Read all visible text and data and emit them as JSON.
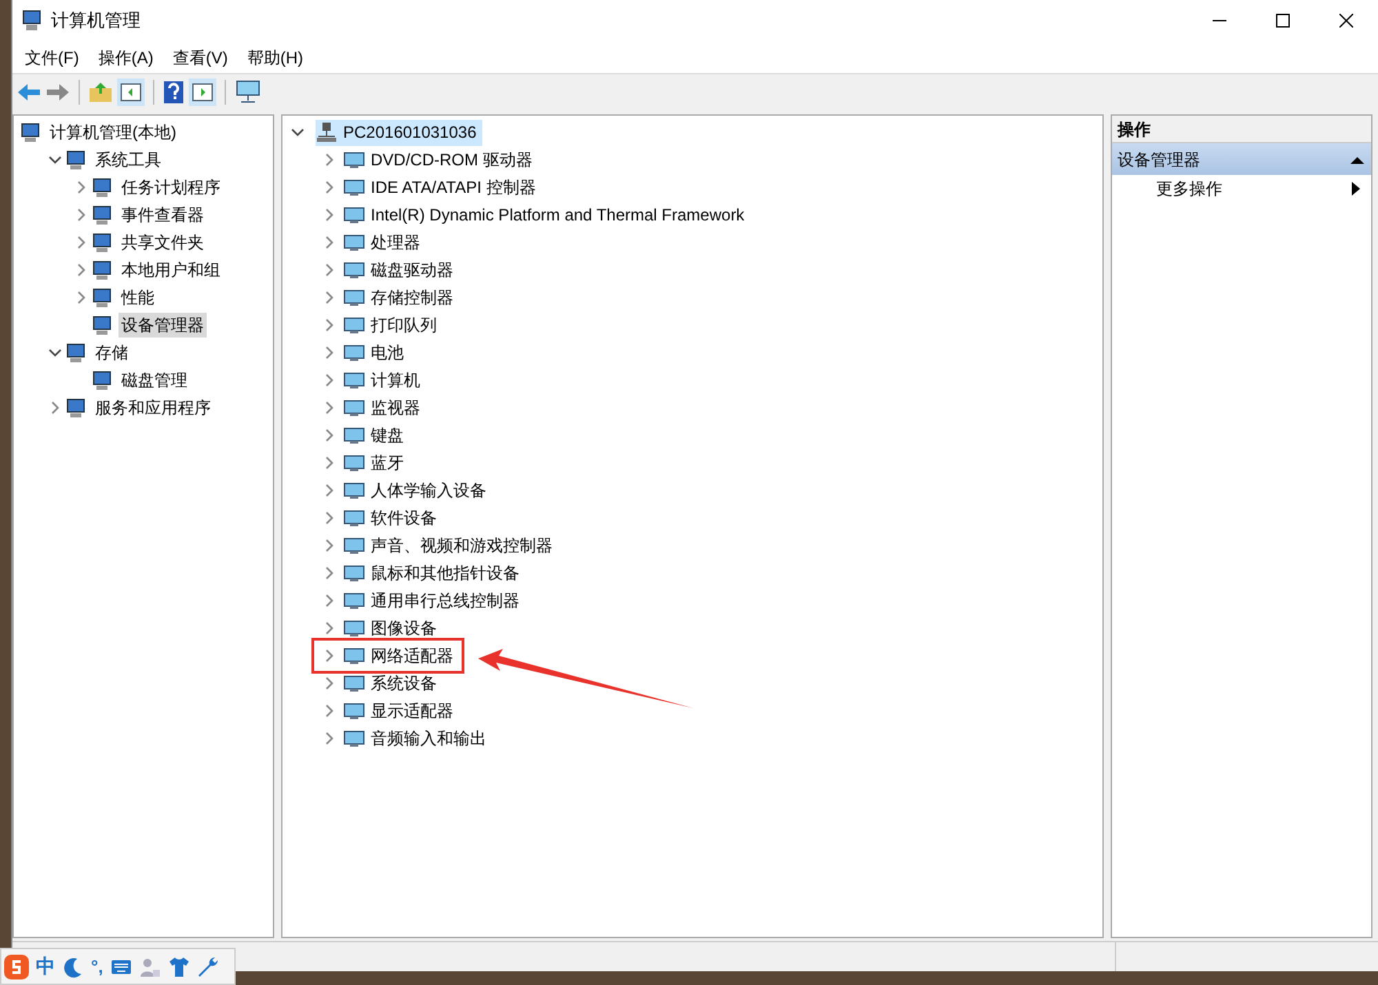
{
  "window": {
    "title": "计算机管理"
  },
  "menu": [
    "文件(F)",
    "操作(A)",
    "查看(V)",
    "帮助(H)"
  ],
  "nav_tree": [
    {
      "label": "计算机管理(本地)",
      "selected": false,
      "children": [
        {
          "label": "系统工具",
          "expanded": true,
          "selected": false,
          "children": [
            {
              "label": "任务计划程序",
              "expanded": false,
              "selected": false
            },
            {
              "label": "事件查看器",
              "expanded": false,
              "selected": false
            },
            {
              "label": "共享文件夹",
              "expanded": false,
              "selected": false
            },
            {
              "label": "本地用户和组",
              "expanded": false,
              "selected": false
            },
            {
              "label": "性能",
              "expanded": false,
              "selected": false
            },
            {
              "label": "设备管理器",
              "selected": true
            }
          ]
        },
        {
          "label": "存储",
          "expanded": true,
          "selected": false,
          "children": [
            {
              "label": "磁盘管理",
              "selected": false
            }
          ]
        },
        {
          "label": "服务和应用程序",
          "expanded": false,
          "selected": false
        }
      ]
    }
  ],
  "device_tree": {
    "root": {
      "label": "PC201601031036",
      "expanded": true,
      "selected": true
    },
    "items": [
      {
        "label": "DVD/CD-ROM 驱动器",
        "expanded": false,
        "highlighted": false
      },
      {
        "label": "IDE ATA/ATAPI 控制器",
        "expanded": false,
        "highlighted": false
      },
      {
        "label": "Intel(R) Dynamic Platform and Thermal Framework",
        "expanded": false,
        "highlighted": false
      },
      {
        "label": "处理器",
        "expanded": false,
        "highlighted": false
      },
      {
        "label": "磁盘驱动器",
        "expanded": false,
        "highlighted": false
      },
      {
        "label": "存储控制器",
        "expanded": false,
        "highlighted": false
      },
      {
        "label": "打印队列",
        "expanded": false,
        "highlighted": false
      },
      {
        "label": "电池",
        "expanded": false,
        "highlighted": false
      },
      {
        "label": "计算机",
        "expanded": false,
        "highlighted": false
      },
      {
        "label": "监视器",
        "expanded": false,
        "highlighted": false
      },
      {
        "label": "键盘",
        "expanded": false,
        "highlighted": false
      },
      {
        "label": "蓝牙",
        "expanded": false,
        "highlighted": false
      },
      {
        "label": "人体学输入设备",
        "expanded": false,
        "highlighted": false
      },
      {
        "label": "软件设备",
        "expanded": false,
        "highlighted": false
      },
      {
        "label": "声音、视频和游戏控制器",
        "expanded": false,
        "highlighted": false
      },
      {
        "label": "鼠标和其他指针设备",
        "expanded": false,
        "highlighted": false
      },
      {
        "label": "通用串行总线控制器",
        "expanded": false,
        "highlighted": false
      },
      {
        "label": "图像设备",
        "expanded": false,
        "highlighted": false
      },
      {
        "label": "网络适配器",
        "expanded": false,
        "highlighted": true
      },
      {
        "label": "系统设备",
        "expanded": false,
        "highlighted": false
      },
      {
        "label": "显示适配器",
        "expanded": false,
        "highlighted": false
      },
      {
        "label": "音频输入和输出",
        "expanded": false,
        "highlighted": false
      }
    ]
  },
  "actions": {
    "header": "操作",
    "section": {
      "label": "设备管理器",
      "expanded": true
    },
    "items": [
      "更多操作"
    ]
  },
  "ime_toolbar": {
    "mode": "中",
    "punctuation": "°,"
  }
}
